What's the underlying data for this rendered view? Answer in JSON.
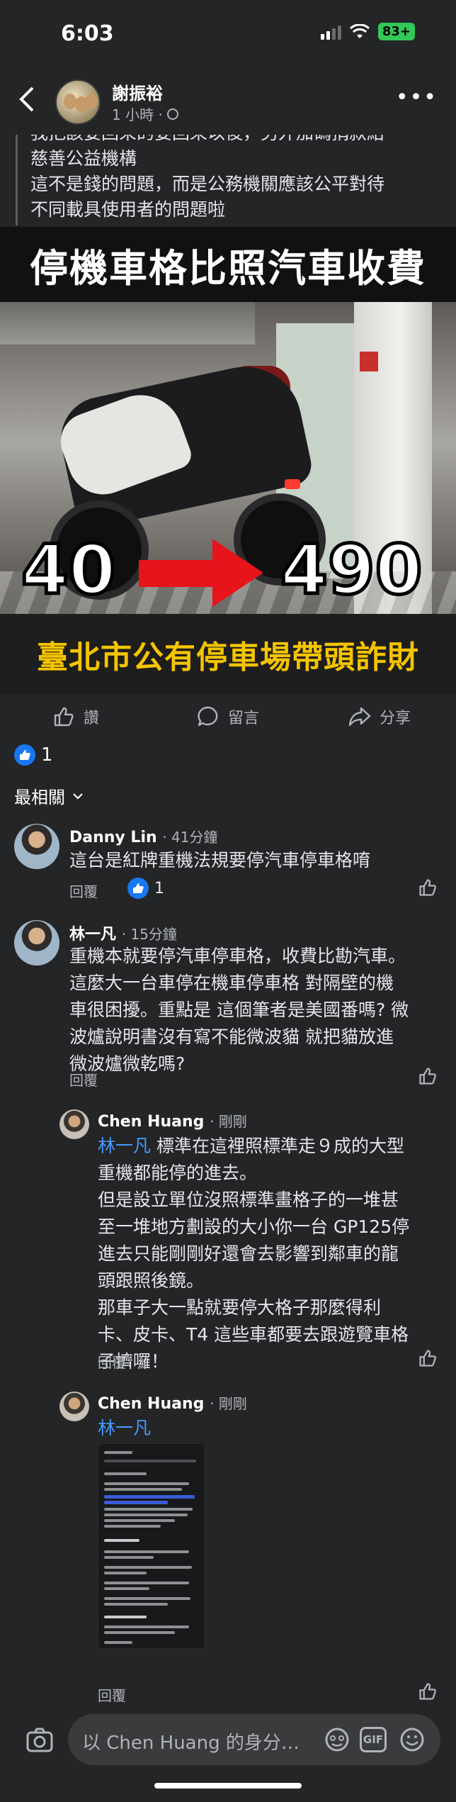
{
  "status_bar": {
    "time": "6:03",
    "battery": "83+"
  },
  "post": {
    "author": "謝振裕",
    "time": "1 小時 ·",
    "quote_lines": [
      "我把該委回來的委回來以後，另外加碼捐款給",
      "慈善公益機構",
      "這不是錢的問題，而是公務機關應該公平對待",
      "不同載具使用者的問題啦"
    ]
  },
  "banner": {
    "title": "停機車格比照汽車收費",
    "price_from": "40",
    "price_to": "490",
    "subtitle": "臺北市公有停車場帶頭詐財"
  },
  "actions": {
    "like": "讚",
    "comment": "留言",
    "share": "分享"
  },
  "reactions": {
    "count": "1"
  },
  "sort": {
    "label": "最相關"
  },
  "comments": [
    {
      "name": "Danny Lin",
      "time": "· 41分鐘",
      "text": "這台是紅牌重機法規要停汽車停車格唷",
      "reply": "回覆",
      "likes": "1"
    },
    {
      "name": "林一凡",
      "time": "· 15分鐘",
      "lines": [
        "重機本就要停汽車停車格，收費比勘汽車。",
        "這麼大一台車停在機車停車格 對隔壁的機",
        "車很困擾。重點是 這個筆者是美國番嗎? 微",
        "波爐說明書沒有寫不能微波貓 就把貓放進",
        "微波爐微乾嗎?"
      ],
      "reply": "回覆"
    },
    {
      "name": "Chen Huang",
      "time": "· 剛剛",
      "mention": "林一凡",
      "first_line_rest": " 標準在這裡照標準走９成的大型",
      "lines": [
        "重機都能停的進去。",
        "但是設立單位沒照標準畫格子的一堆甚",
        "至一堆地方劃設的大小你一台 GP125停",
        "進去只能剛剛好還會去影響到鄰車的龍",
        "頭跟照後鏡。",
        "那車子大一點就要停大格子那麼得利",
        "卡、皮卡、T4 這些車都要去跟遊覽車格",
        "子擠囉！"
      ],
      "reply": "回覆"
    },
    {
      "name": "Chen Huang",
      "time": "· 剛剛",
      "mention": "林一凡",
      "reply": "回覆"
    }
  ],
  "composer": {
    "placeholder": "以 Chen Huang 的身分…",
    "gif": "GIF"
  },
  "colors": {
    "accent": "#1877f2",
    "mention": "#4599ff",
    "banner_subtitle": "#f4c400",
    "arrow": "#e8141b"
  },
  "icons": [
    "back-icon",
    "globe-icon",
    "more-icon",
    "like-icon",
    "comment-icon",
    "share-icon",
    "camera-icon",
    "sticker-icon",
    "gif-icon",
    "emoji-icon"
  ]
}
